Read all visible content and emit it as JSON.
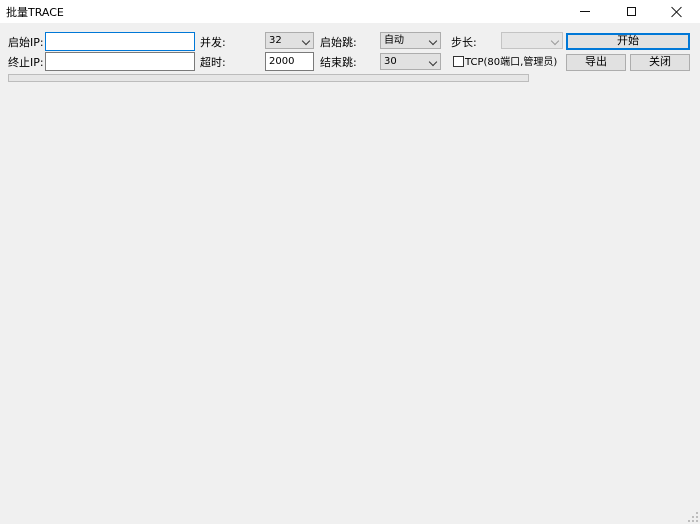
{
  "window": {
    "title": "批量TRACE"
  },
  "form": {
    "start_ip_label": "启始IP:",
    "start_ip_value": "",
    "end_ip_label": "终止IP:",
    "end_ip_value": "",
    "concurrency_label": "并发:",
    "concurrency_value": "32",
    "timeout_label": "超时:",
    "timeout_value": "2000",
    "start_hop_label": "启始跳:",
    "start_hop_value": "自动",
    "end_hop_label": "结束跳:",
    "end_hop_value": "30",
    "step_label": "步长:",
    "step_value": "",
    "tcp_label": "TCP(80端口,管理员)",
    "tcp_checked": false
  },
  "buttons": {
    "start": "开始",
    "export": "导出",
    "close": "关闭"
  },
  "progress": {
    "percent": 0
  },
  "icons": {
    "minimize": "minimize-icon",
    "maximize": "maximize-icon",
    "close": "close-icon",
    "dropdown": "chevron-down-icon",
    "resize": "resize-grip-icon"
  },
  "colors": {
    "window_bg": "#f0f0f0",
    "titlebar_bg": "#ffffff",
    "focus": "#0078d7",
    "button_bg": "#e1e1e1"
  }
}
